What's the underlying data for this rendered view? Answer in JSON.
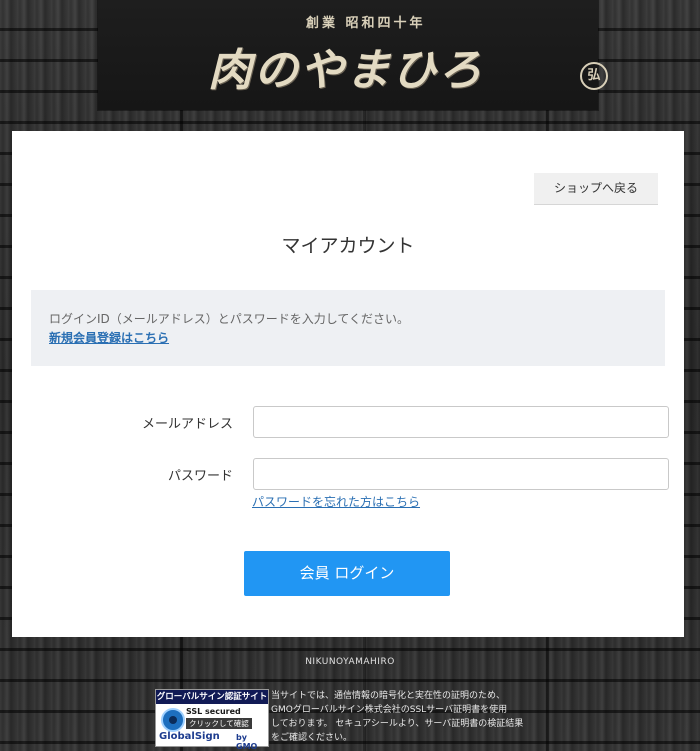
{
  "header": {
    "logo_subtitle": "創業 昭和四十年",
    "logo_title": "肉のやまひろ",
    "logo_seal": "弘"
  },
  "card": {
    "back_button": "ショップへ戻る",
    "title": "マイアカウント",
    "info": {
      "message": "ログインID（メールアドレス）とパスワードを入力してください。",
      "register_link": "新規会員登録はこちら"
    },
    "form": {
      "email_label": "メールアドレス",
      "email_value": "",
      "password_label": "パスワード",
      "password_value": "",
      "forgot_link": "パスワードを忘れた方はこちら",
      "submit_label": "会員 ログイン"
    }
  },
  "footer": {
    "brand": "NIKUNOYAMAHIRO",
    "seal": {
      "heading": "グローバルサイン認証サイト",
      "ssl": "SSL secured",
      "click": "クリックして確認",
      "brand": "GlobalSign",
      "by": "by GMO",
      "description": "当サイトでは、通信情報の暗号化と実在性の証明のため、\nGMOグローバルサイン株式会社のSSLサーバ証明書を使用\nしております。 セキュアシールより、サーバ証明書の検証結果\nをご確認ください。"
    }
  },
  "colors": {
    "accent": "#2196f3",
    "link": "#2a6fb3",
    "info_bg": "#eef0f3"
  }
}
